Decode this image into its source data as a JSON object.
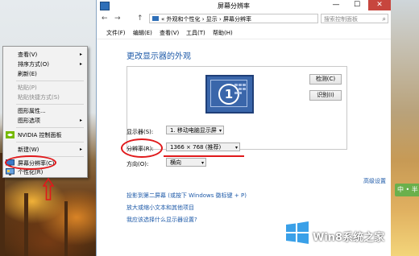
{
  "window": {
    "title": "屏幕分辨率",
    "controls": {
      "minimize": "—",
      "maximize": "☐",
      "close": "✕"
    }
  },
  "address_bar": {
    "back": "←",
    "forward": "→",
    "up": "↑",
    "path": "« 外观和个性化 › 显示 › 屏幕分辨率",
    "search_placeholder": "搜索控制面板"
  },
  "menu_bar": [
    "文件(F)",
    "编辑(E)",
    "查看(V)",
    "工具(T)",
    "帮助(H)"
  ],
  "main": {
    "heading": "更改显示器的外观",
    "monitor_number": "1",
    "detect_button": "检测(C)",
    "identify_button": "识别(I)",
    "display_label": "显示器(S):",
    "display_value": "1. 移动电脑显示屏",
    "resolution_label": "分辨率(R):",
    "resolution_value": "1366 × 768 (推荐)",
    "orientation_label": "方向(O):",
    "orientation_value": "横向",
    "advanced_link": "高级设置",
    "links": [
      "投影到第二屏幕 (或按下 Windows 徽标键 + P)",
      "放大或缩小文本和其他项目",
      "我应该选择什么显示器设置?"
    ]
  },
  "context_menu": {
    "items": [
      {
        "label": "查看(V)",
        "submenu": true,
        "disabled": false
      },
      {
        "label": "排序方式(O)",
        "submenu": true,
        "disabled": false
      },
      {
        "label": "刷新(E)",
        "submenu": false,
        "disabled": false
      },
      {
        "label": "粘贴(P)",
        "submenu": false,
        "disabled": true
      },
      {
        "label": "粘贴快捷方式(S)",
        "submenu": false,
        "disabled": true
      },
      {
        "label": "图形属性...",
        "submenu": false,
        "disabled": false
      },
      {
        "label": "图形选项",
        "submenu": true,
        "disabled": false
      },
      {
        "label": "NVIDIA 控制面板",
        "submenu": false,
        "disabled": false
      },
      {
        "label": "新建(W)",
        "submenu": true,
        "disabled": false
      },
      {
        "label": "屏幕分辨率(C)",
        "submenu": false,
        "disabled": false
      },
      {
        "label": "个性化(R)",
        "submenu": false,
        "disabled": false
      }
    ],
    "arrow_glyph": "▸"
  },
  "watermark": {
    "text": "Win8系统之家"
  },
  "side_tab": "中 • 半",
  "colors": {
    "accent": "#1e5aa8",
    "annotation": "#e0191b",
    "close": "#c7463e"
  }
}
